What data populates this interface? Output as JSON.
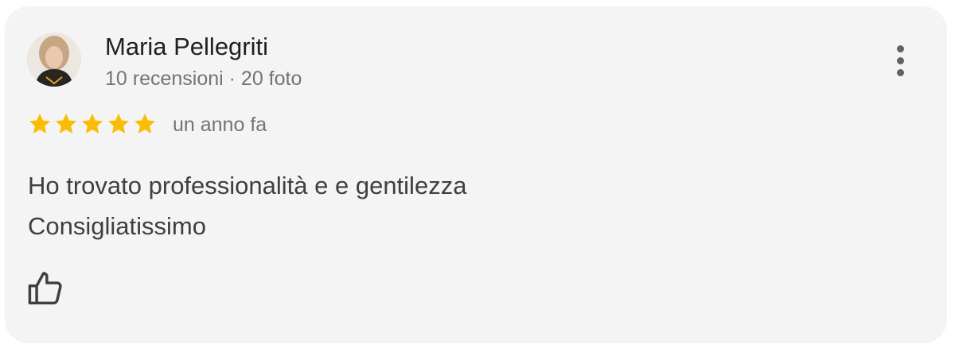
{
  "review": {
    "author": {
      "name": "Maria Pellegriti",
      "meta": "10 recensioni · 20 foto",
      "avatar": "profile-photo"
    },
    "rating": 5,
    "rating_max": 5,
    "star_color": "#fbbc04",
    "date": "un anno fa",
    "text": {
      "line1": "Ho trovato professionalità e e gentilezza",
      "line2": "Consigliatissimo"
    },
    "actions": {
      "more": "more-vert-icon",
      "like": "thumb-up-icon"
    }
  }
}
